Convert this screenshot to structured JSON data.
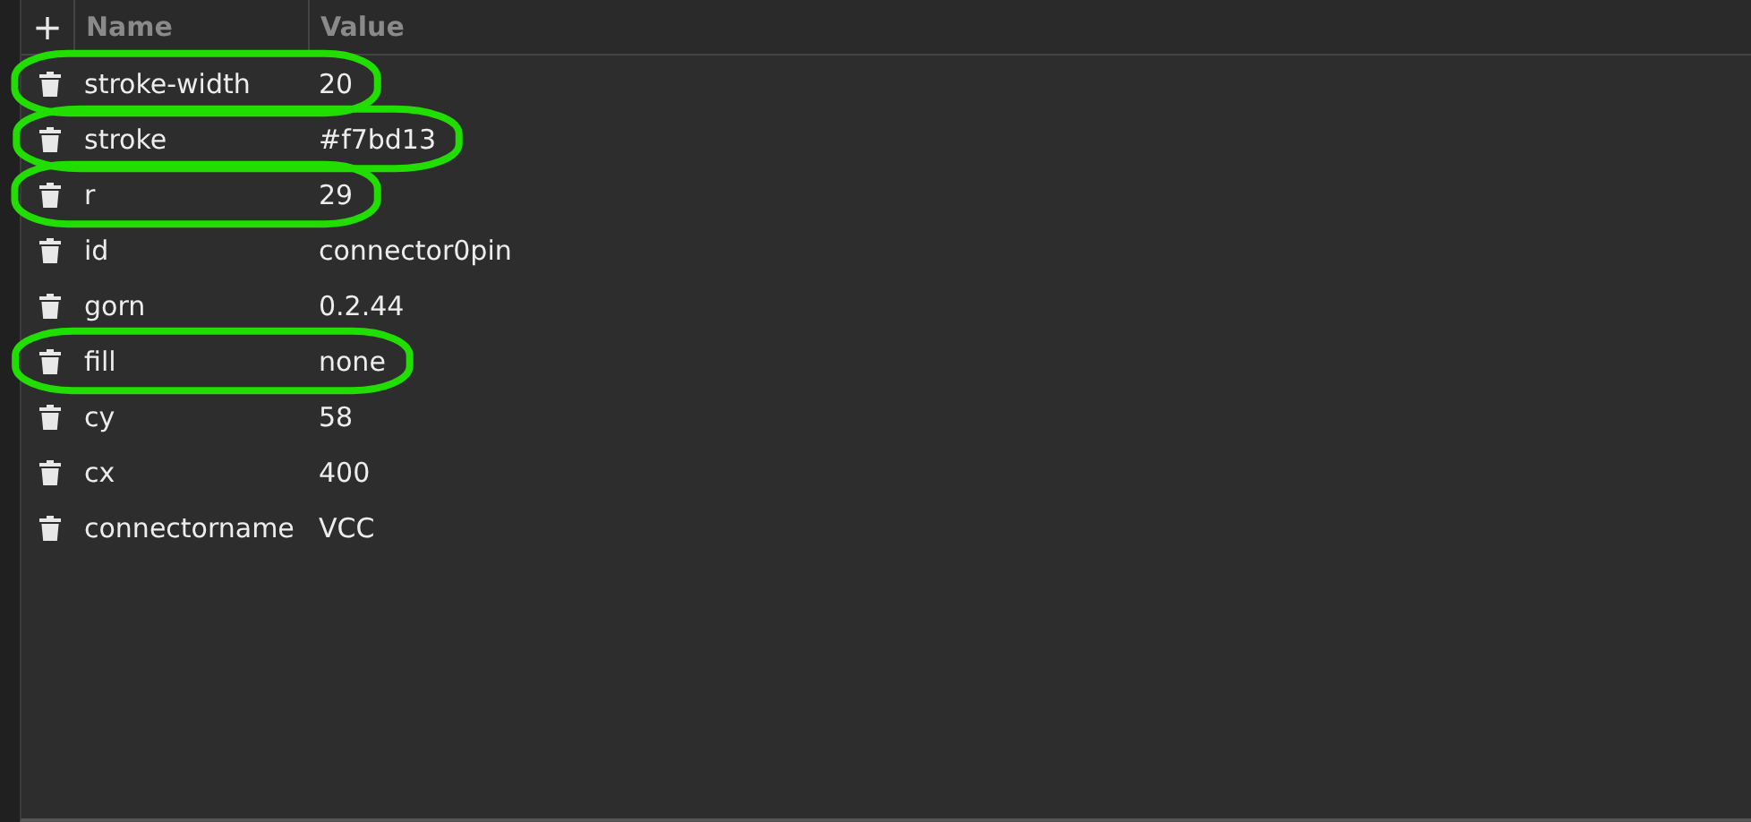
{
  "header": {
    "add": "+",
    "columns": [
      "Name",
      "Value"
    ]
  },
  "rows": [
    {
      "name": "stroke-width",
      "value": "20",
      "highlighted": true
    },
    {
      "name": "stroke",
      "value": "#f7bd13",
      "highlighted": true
    },
    {
      "name": "r",
      "value": "29",
      "highlighted": true
    },
    {
      "name": "id",
      "value": "connector0pin",
      "highlighted": false
    },
    {
      "name": "gorn",
      "value": "0.2.44",
      "highlighted": false
    },
    {
      "name": "fill",
      "value": "none",
      "highlighted": true
    },
    {
      "name": "cy",
      "value": "58",
      "highlighted": false
    },
    {
      "name": "cx",
      "value": "400",
      "highlighted": false
    },
    {
      "name": "connectorname",
      "value": "VCC",
      "highlighted": false
    }
  ]
}
